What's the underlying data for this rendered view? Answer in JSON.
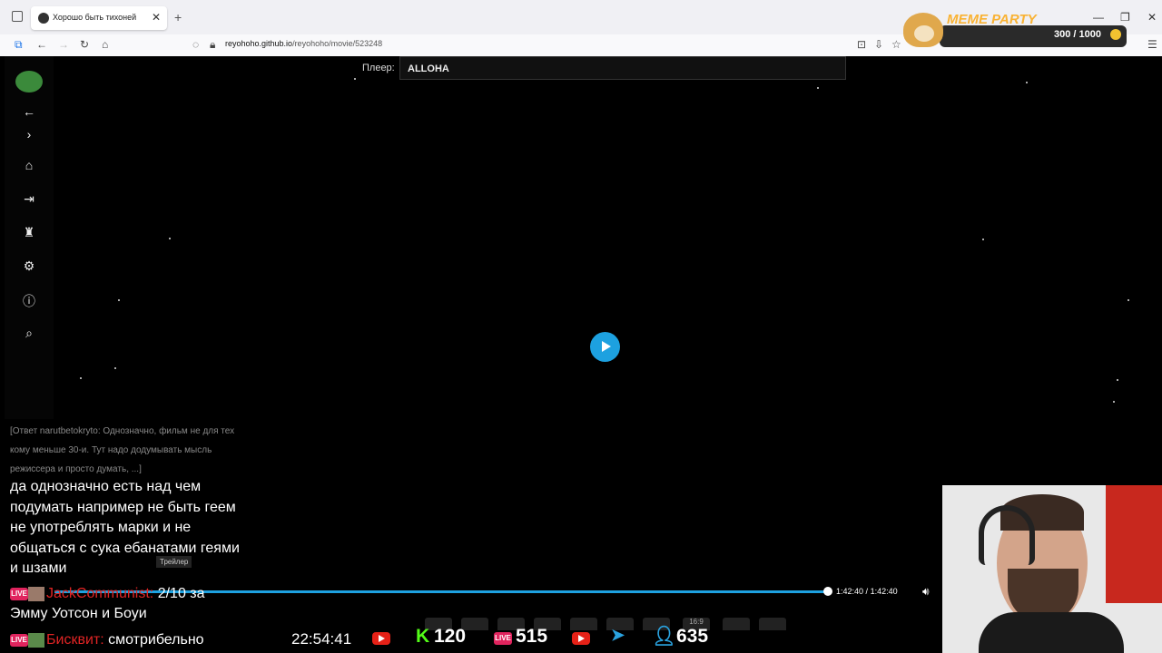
{
  "browser": {
    "tab_title": "Хорошо быть тихоней",
    "new_tab": "+",
    "url_host": "reyohoho.github.io",
    "url_path": "/reyohoho/movie/523248",
    "close_tab": "✕"
  },
  "overlay": {
    "brand": "MEME PARTY",
    "counter": "300 / 1000"
  },
  "sidebar": {
    "items": [
      "back",
      "forward",
      "home",
      "login",
      "top",
      "settings",
      "info",
      "search"
    ]
  },
  "player": {
    "label": "Плеер:",
    "selected": "ALLOHA",
    "trailer_label": "Трейлер",
    "time_current": "1:42:40",
    "time_separator": "/",
    "time_total": "1:42:40",
    "progress": 1.0,
    "aspect_label": "16:9"
  },
  "chat": {
    "old_message": "[Ответ narutbetokryto: Однозначно, фильм не для тех кому меньше 30-и. Тут надо додумывать мысль режиссера и просто думать, ...]",
    "main_message": "да однозначно есть над чем подумать например не быть геем не употреблять марки и не общаться с сука ебанатами геями и шзами",
    "msg1_user": "JackCommunist:",
    "msg1_text": "2/10 за",
    "msg1_cont": "Эмму Уотсон и Боуи",
    "msg2_user": "Бисквит:",
    "msg2_text": "смотрибельно",
    "live_badge": "LIVE"
  },
  "stream": {
    "clock": "22:54:41",
    "kick_viewers": "120",
    "live_viewers": "515",
    "total_viewers": "635",
    "kick_letter": "K"
  }
}
